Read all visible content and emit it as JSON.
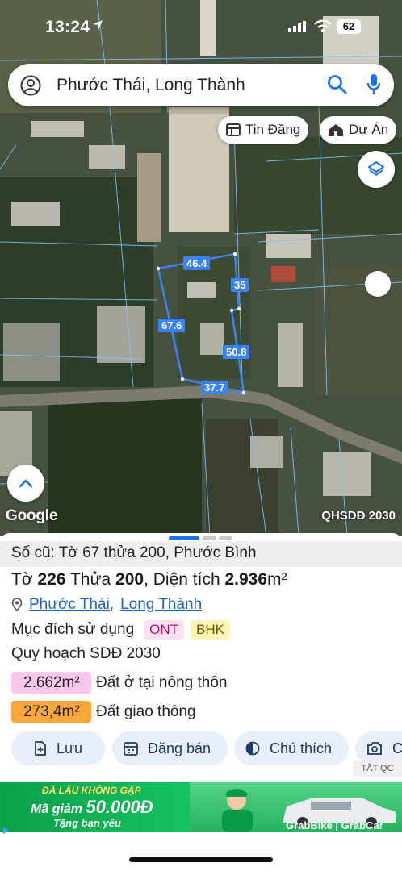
{
  "status_bar": {
    "time": "13:24",
    "battery": "62"
  },
  "search": {
    "value": "Phước Thái, Long Thành",
    "placeholder": ""
  },
  "chips": {
    "tin_dang": "Tin Đăng",
    "du_an": "Dự Án"
  },
  "map": {
    "attribution": "Google",
    "layer_label": "QHSDĐ 2030",
    "dimensions": [
      "46.4",
      "35",
      "67.6",
      "50.8",
      "37.7"
    ],
    "parcel_color": "#3b82f6"
  },
  "parcel": {
    "old_info": "Số cũ: Tờ 67 thửa 200, Phước Bình",
    "title_prefix": "Tờ ",
    "sheet_no": "226",
    "lot_label": " Thửa ",
    "lot_no": "200",
    "area_label": ", Diện tích ",
    "area": "2.936",
    "area_unit": "m²",
    "ward": "Phước Thái",
    "district": "Long Thành",
    "purpose_label": "Mục đích sử dụng",
    "purpose_tags": [
      "ONT",
      "BHK"
    ],
    "plan_label": "Quy hoạch SDĐ 2030",
    "plan_areas": [
      {
        "value": "2.662m²",
        "label": "Đất ở tại nông thôn",
        "color": "#fbc6ec"
      },
      {
        "value": "273,4m²",
        "label": "Đất giao thông",
        "color": "#fba63b"
      }
    ]
  },
  "actions": {
    "save": "Lưu",
    "post_sale": "Đăng bán",
    "legend": "Chú thích",
    "more": "C"
  },
  "ad": {
    "close_label": "TẮT QC",
    "line1": "ĐÃ LÂU KHÔNG GẶP",
    "line2_prefix": "Mã giảm ",
    "line2_amount": "50.000Đ",
    "line3": "Tặng bạn yêu",
    "brand": "GrabBike | GrabCar"
  }
}
